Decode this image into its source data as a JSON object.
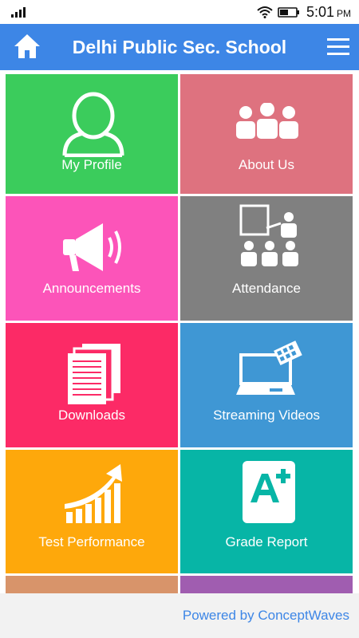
{
  "status_bar": {
    "time": "5:01",
    "ampm": "PM",
    "icons": [
      "signal-icon",
      "wifi-icon",
      "battery-icon"
    ]
  },
  "header": {
    "title": "Delhi Public Sec. School",
    "background": "#3d86e6",
    "left_icon": "home-icon",
    "right_icon": "hamburger-menu-icon"
  },
  "tiles": [
    {
      "label": "My Profile",
      "icon": "user-profile-icon",
      "color": "#3bcc5c"
    },
    {
      "label": "About Us",
      "icon": "group-icon",
      "color": "#de727f"
    },
    {
      "label": "Announcements",
      "icon": "megaphone-icon",
      "color": "#fc54b9"
    },
    {
      "label": "Attendance",
      "icon": "classroom-icon",
      "color": "#808080"
    },
    {
      "label": "Downloads",
      "icon": "documents-icon",
      "color": "#fc2a66"
    },
    {
      "label": "Streaming Videos",
      "icon": "laptop-video-icon",
      "color": "#3f97d4"
    },
    {
      "label": "Test Performance",
      "icon": "growth-chart-icon",
      "color": "#fea80b"
    },
    {
      "label": "Grade Report",
      "icon": "grade-a-plus-icon",
      "color": "#07b5a6"
    }
  ],
  "footer": {
    "powered_by": "Powered by ConceptWaves"
  }
}
